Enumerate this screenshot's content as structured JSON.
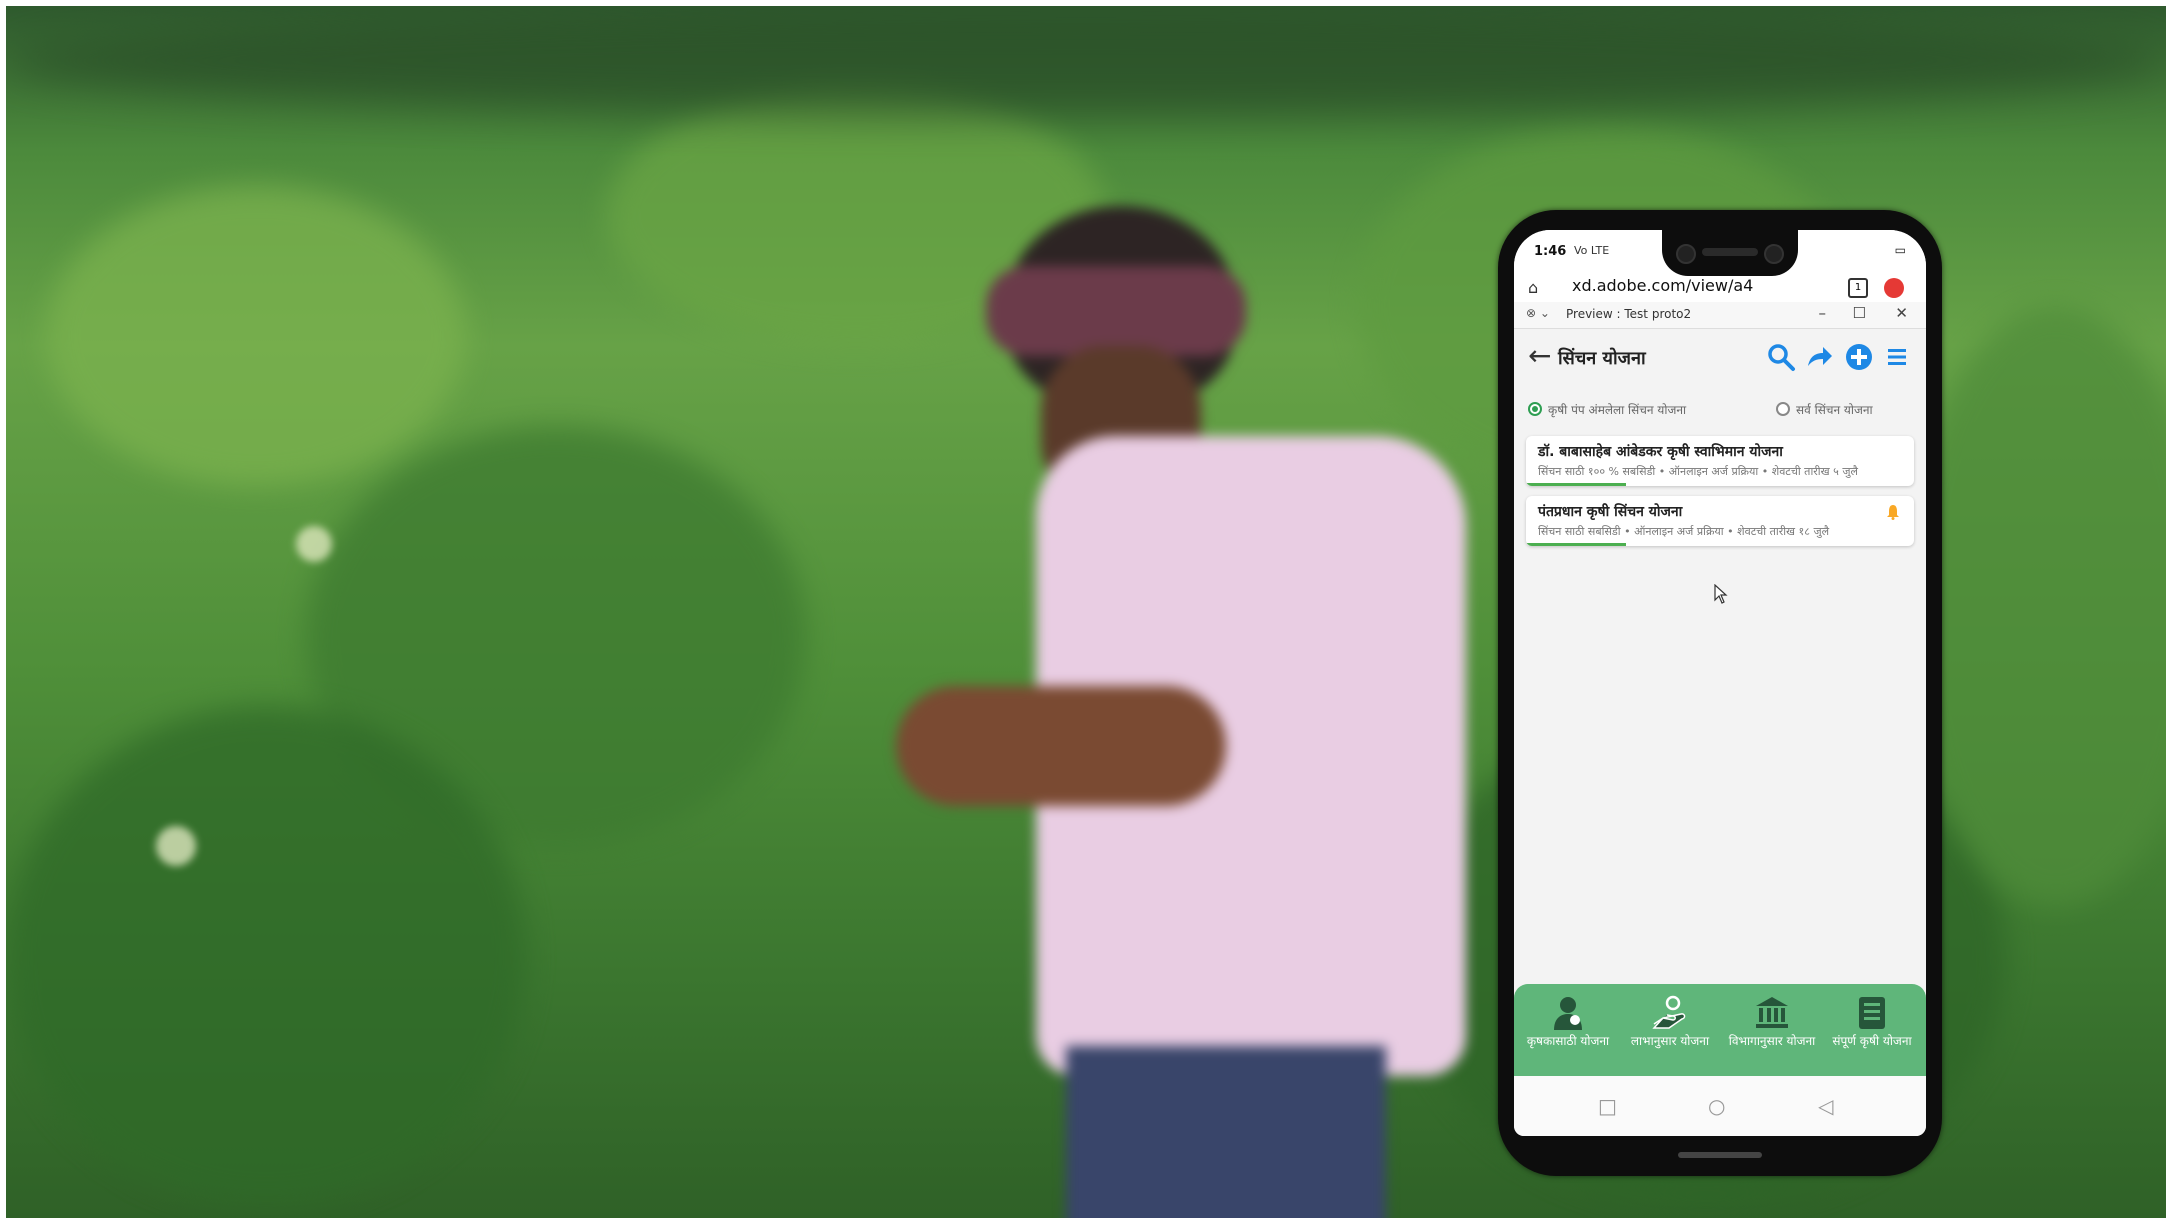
{
  "phone": {
    "status_time": "1:46",
    "status_signal": "Vo LTE",
    "status_battery": "▭",
    "url_text": "xd.adobe.com/view/a4",
    "tabs_count": "1",
    "preview_title": "Preview : Test proto2",
    "window_controls": [
      "–",
      "☐",
      "✕"
    ],
    "app_title": "सिंचन योजना",
    "header_icons": [
      "search-icon",
      "share-icon",
      "add-circle-icon",
      "menu-icon"
    ],
    "filters": [
      {
        "label": "कृषी पंप अंमलेला सिंचन योजना",
        "selected": true
      },
      {
        "label": "सर्व सिंचन योजना",
        "selected": false
      }
    ],
    "schemes": [
      {
        "title": "डॉ. बाबासाहेब आंबेडकर कृषी स्वाभिमान योजना",
        "subtitle": "सिंचन साठी १०० % सबसिडी • ऑनलाइन अर्ज प्रक्रिया • शेवटची तारीख ५ जुलै",
        "bell": false
      },
      {
        "title": "पंतप्रधान कृषी सिंचन योजना",
        "subtitle": "सिंचन साठी सबसिडी • ऑनलाइन अर्ज प्रक्रिया • शेवटची तारीख १८ जुलै",
        "bell": true
      }
    ],
    "bottom_nav": [
      {
        "label": "कृषकासाठी योजना",
        "icon": "farmer-icon"
      },
      {
        "label": "लाभानुसार योजना",
        "icon": "benefit-icon"
      },
      {
        "label": "विभागानुसार योजना",
        "icon": "department-icon"
      },
      {
        "label": "संपूर्ण कृषी योजना",
        "icon": "list-icon"
      }
    ],
    "system_nav": [
      "□",
      "○",
      "◁"
    ]
  },
  "colors": {
    "accent": "#1e88e5",
    "nav_green": "#5fb67a",
    "radio_green": "#2e9e52"
  }
}
